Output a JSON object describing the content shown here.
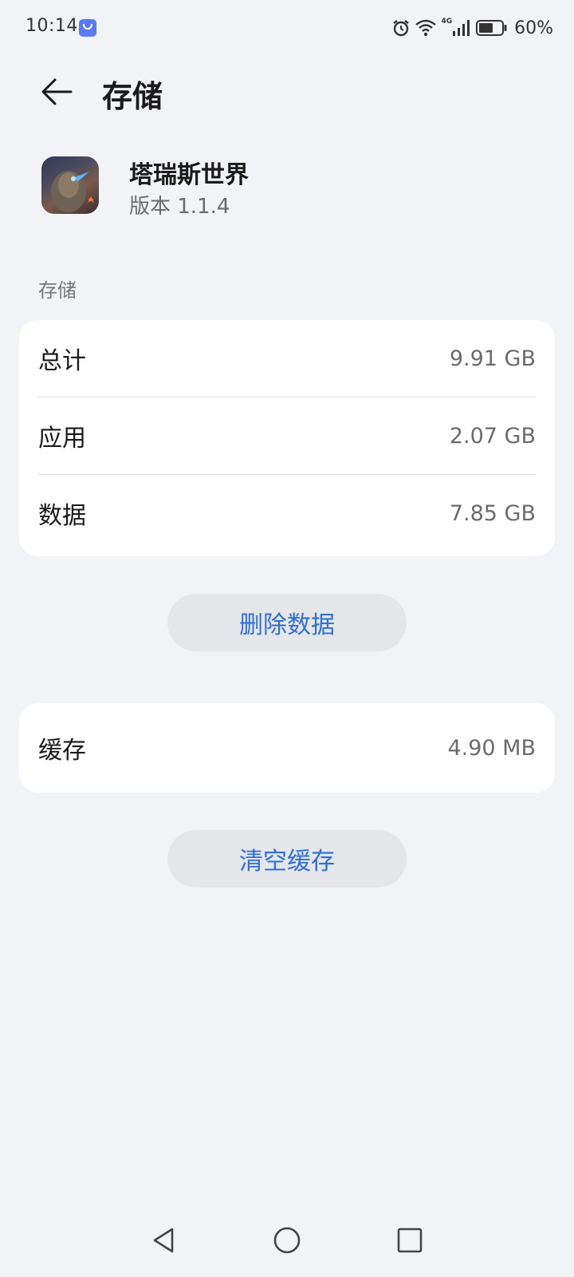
{
  "status_bar": {
    "time": "10:14",
    "network_type": "4G",
    "battery": "60%"
  },
  "header": {
    "title": "存储",
    "back_icon": "arrow-left-icon"
  },
  "app": {
    "name": "塔瑞斯世界",
    "version": "版本 1.1.4"
  },
  "storage_section": {
    "label": "存储",
    "rows": [
      {
        "label": "总计",
        "value": "9.91 GB"
      },
      {
        "label": "应用",
        "value": "2.07 GB"
      },
      {
        "label": "数据",
        "value": "7.85 GB"
      }
    ],
    "delete_button": "删除数据"
  },
  "cache_section": {
    "label": "缓存",
    "value": "4.90 MB",
    "clear_button": "清空缓存"
  },
  "colors": {
    "background": "#f1f3f6",
    "card": "#ffffff",
    "accent": "#2f6fd9",
    "button_bg": "#e4e6ea"
  }
}
